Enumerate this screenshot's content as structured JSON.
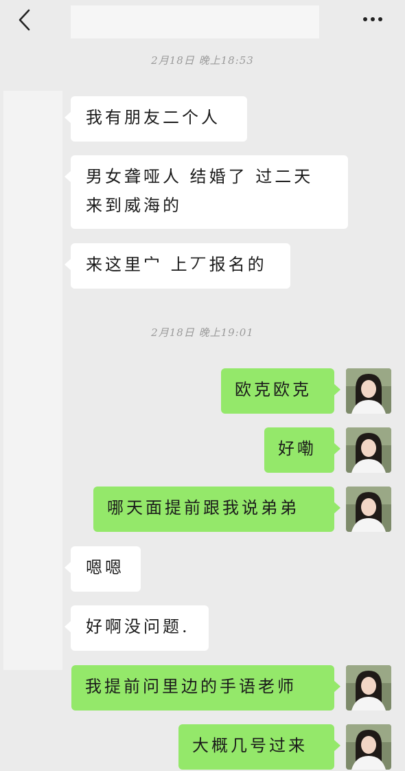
{
  "header": {
    "title": "",
    "back_icon": "chevron-left-icon",
    "more_icon": "more-dots-icon"
  },
  "timestamps": [
    "2月18日 晚上18:53",
    "2月18日 晚上19:01"
  ],
  "messages": [
    {
      "side": "incoming",
      "text": "我有朋友二个人"
    },
    {
      "side": "incoming",
      "lines": [
        "男女聋哑人 结婚了 过二天",
        "来到威海的"
      ]
    },
    {
      "side": "incoming",
      "text": "来这里宀 上丆报名的"
    },
    {
      "side": "outgoing",
      "text": "欧克欧克"
    },
    {
      "side": "outgoing",
      "text": "好嘞"
    },
    {
      "side": "outgoing",
      "text": "哪天面提前跟我说弟弟"
    },
    {
      "side": "incoming",
      "text": "嗯嗯"
    },
    {
      "side": "incoming",
      "text": "好啊没问题."
    },
    {
      "side": "outgoing",
      "text": "我提前问里边的手语老师"
    },
    {
      "side": "outgoing",
      "text": "大概几号过来"
    }
  ],
  "colors": {
    "background": "#ebebeb",
    "incoming_bubble": "#ffffff",
    "outgoing_bubble": "#94e86a",
    "timestamp": "#9a9a9a"
  }
}
